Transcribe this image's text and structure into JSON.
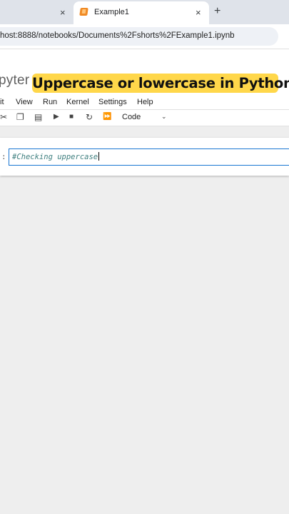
{
  "browser": {
    "active_tab_title": "Example1",
    "url": "host:8888/notebooks/Documents%2Fshorts%2FExample1.ipynb",
    "close_glyph": "×",
    "new_tab_glyph": "+"
  },
  "jupyter": {
    "logo_text": "pyter",
    "banner_text": "Uppercase or lowercase in Python",
    "menu": [
      "it",
      "View",
      "Run",
      "Kernel",
      "Settings",
      "Help"
    ],
    "toolbar": {
      "cell_type": "Code",
      "icons": [
        "cut-icon",
        "copy-icon",
        "paste-icon",
        "run-icon",
        "stop-icon",
        "restart-icon",
        "fast-forward-icon"
      ]
    }
  },
  "cell": {
    "prompt": ":",
    "code": "#Checking uppercase"
  },
  "colors": {
    "banner": "#ffd74a",
    "active_cell_border": "#1976d2",
    "comment": "#408080",
    "nb_icon": "#f08a24"
  }
}
